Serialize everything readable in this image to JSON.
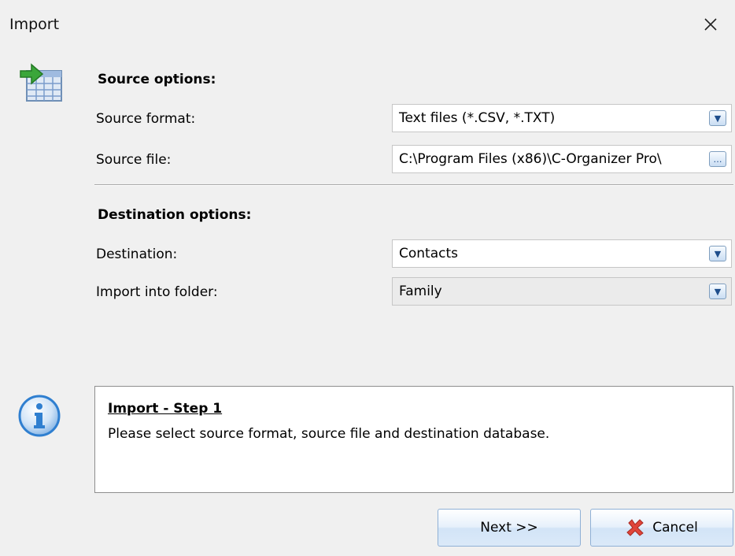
{
  "window": {
    "title": "Import"
  },
  "source": {
    "heading": "Source options:",
    "format_label": "Source format:",
    "format_value": "Text files (*.CSV, *.TXT)",
    "file_label": "Source file:",
    "file_value": "C:\\Program Files (x86)\\C-Organizer Pro\\"
  },
  "destination": {
    "heading": "Destination options:",
    "destination_label": "Destination:",
    "destination_value": "Contacts",
    "folder_label": "Import into folder:",
    "folder_value": "Family"
  },
  "info": {
    "title": "Import - Step 1",
    "text": "Please select source format, source file and destination database."
  },
  "buttons": {
    "next": "Next >>",
    "cancel": "Cancel"
  },
  "icons": {
    "import": "import-table-icon",
    "info": "info-icon",
    "cancel": "red-x-icon",
    "close": "close-icon",
    "dropdown": "chevron-down-icon",
    "browse": "ellipsis-icon"
  },
  "colors": {
    "info_blue": "#2f7fd0",
    "cancel_red": "#e0453a",
    "arrow_green": "#3aa63a"
  }
}
